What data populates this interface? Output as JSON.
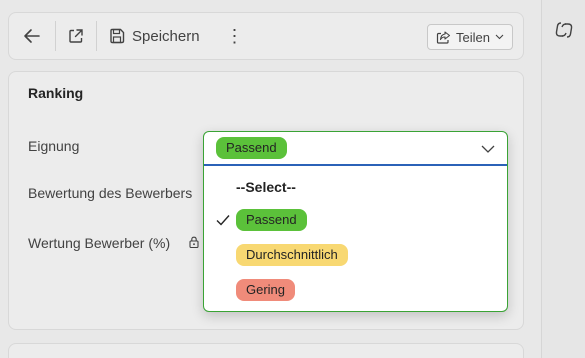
{
  "toolbar": {
    "save_label": "Speichern",
    "more_label": "⋮",
    "share_label": "Teilen"
  },
  "section": {
    "title": "Ranking",
    "fields": [
      {
        "label": "Eignung"
      },
      {
        "label": "Bewertung des Bewerbers"
      },
      {
        "label": "Wertung Bewerber (%)"
      }
    ]
  },
  "dropdown": {
    "selected": {
      "label": "Passend",
      "color": "#5bc13a"
    },
    "options": [
      {
        "label": "--Select--"
      },
      {
        "label": "Passend",
        "color": "#5bc13a",
        "checked": true
      },
      {
        "label": "Durchschnittlich",
        "color": "#f8d872"
      },
      {
        "label": "Gering",
        "color": "#f08b7a"
      }
    ]
  },
  "icons": {
    "back": "arrow-left-icon",
    "popout": "open-in-new-icon",
    "save": "floppy-disk-icon",
    "share": "share-icon",
    "rail": "copilot-icon",
    "lock": "lock-icon",
    "check": "checkmark-icon",
    "chevron": "chevron-down-icon"
  },
  "colors": {
    "accent_green": "#3aa335",
    "focus_blue": "#2b62b8"
  }
}
